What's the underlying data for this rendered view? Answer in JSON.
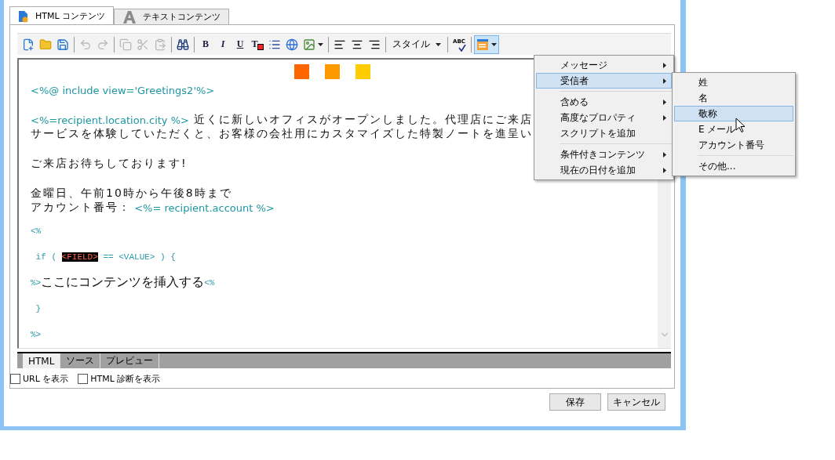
{
  "tabs": [
    {
      "label": "HTML コンテンツ",
      "kind": "html",
      "selected": true
    },
    {
      "label": "テキストコンテンツ",
      "kind": "text",
      "selected": false
    }
  ],
  "toolbar": {
    "groups": [
      [
        {
          "kind": "new",
          "disabled": false,
          "pressed": false
        },
        {
          "kind": "open",
          "disabled": false,
          "pressed": false
        },
        {
          "kind": "save",
          "disabled": false,
          "pressed": false
        }
      ],
      [
        {
          "kind": "undo",
          "disabled": true,
          "pressed": false
        },
        {
          "kind": "redo",
          "disabled": true,
          "pressed": false
        }
      ],
      [
        {
          "kind": "copy",
          "disabled": true,
          "pressed": false
        },
        {
          "kind": "cut",
          "disabled": true,
          "pressed": false
        },
        {
          "kind": "paste",
          "disabled": true,
          "pressed": false
        }
      ],
      [
        {
          "kind": "find",
          "disabled": false,
          "pressed": false
        }
      ],
      [
        {
          "kind": "bold",
          "label": "B",
          "disabled": false,
          "pressed": false
        },
        {
          "kind": "italic",
          "label": "I",
          "disabled": false,
          "pressed": false
        },
        {
          "kind": "underline",
          "label": "U",
          "disabled": false,
          "pressed": false
        },
        {
          "kind": "textcolor",
          "label": "T",
          "disabled": false,
          "pressed": false
        },
        {
          "kind": "list",
          "disabled": false,
          "pressed": false
        },
        {
          "kind": "link",
          "disabled": false,
          "pressed": false
        },
        {
          "kind": "image",
          "dropdown": true,
          "disabled": false,
          "pressed": false
        }
      ],
      [
        {
          "kind": "alignleft",
          "disabled": false,
          "pressed": false
        },
        {
          "kind": "aligncenter",
          "disabled": false,
          "pressed": false
        },
        {
          "kind": "alignright",
          "disabled": false,
          "pressed": false
        }
      ],
      [
        {
          "kind": "style",
          "label": "スタイル",
          "dropdown": true,
          "disabled": false,
          "pressed": false
        }
      ],
      [
        {
          "kind": "spell",
          "label": "ABC",
          "disabled": false,
          "pressed": false
        }
      ],
      [
        {
          "kind": "personalize",
          "dropdown": true,
          "disabled": false,
          "pressed": true
        }
      ]
    ]
  },
  "editor": {
    "swatches": [
      {
        "color": "#ff6600"
      },
      {
        "color": "#ff9900"
      },
      {
        "color": "#ffcc00"
      }
    ],
    "blocks": [
      {
        "kind": "para",
        "lines": [
          [
            {
              "kind": "tag",
              "text": "<%@ include view='Greetings2'%>"
            }
          ]
        ]
      },
      {
        "kind": "para",
        "lines": [
          [
            {
              "kind": "tag",
              "text": "<%=recipient.location.city %>"
            },
            {
              "kind": "text",
              "text": " 近くに新しいオフィスがオープンしました。代理店にご来店"
            }
          ],
          [
            {
              "kind": "text",
              "text": "サービスを体験していただくと、お客様の会社用にカスタマイズした特製ノートを進呈い"
            }
          ]
        ]
      },
      {
        "kind": "para",
        "lines": [
          [
            {
              "kind": "text",
              "text": "ご来店お待ちしております!"
            }
          ]
        ]
      },
      {
        "kind": "para",
        "lines": [
          [
            {
              "kind": "text",
              "text": "金曜日、午前10時から午後8時まで"
            }
          ],
          [
            {
              "kind": "text",
              "text": "アカウント番号："
            },
            {
              "kind": "tag",
              "text": " <%= recipient.account %>"
            }
          ]
        ]
      },
      {
        "kind": "code",
        "lines": [
          [
            {
              "kind": "code",
              "text": "<%"
            }
          ],
          [
            {
              "kind": "code",
              "text": " if ( "
            },
            {
              "kind": "field",
              "text": "<FIELD>"
            },
            {
              "kind": "code",
              "text": " == <VALUE> ) {"
            }
          ],
          [
            {
              "kind": "code",
              "text": "%>"
            },
            {
              "kind": "large",
              "text": "ここにコンテンツを挿入する"
            },
            {
              "kind": "code",
              "text": "<%"
            }
          ],
          [
            {
              "kind": "code",
              "text": " }"
            }
          ],
          [
            {
              "kind": "code",
              "text": "%>"
            }
          ]
        ]
      }
    ]
  },
  "view_tabs": [
    {
      "label": "HTML",
      "selected": true
    },
    {
      "label": "ソース",
      "selected": false
    },
    {
      "label": "プレビュー",
      "selected": false
    }
  ],
  "options": [
    {
      "label": "URL を表示",
      "checked": false
    },
    {
      "label": "HTML 診断を表示",
      "checked": false
    }
  ],
  "buttons": [
    "保存",
    "キャンセル"
  ],
  "menu": {
    "groups": [
      [
        {
          "label": "メッセージ",
          "submenu": true,
          "selected": false
        },
        {
          "label": "受信者",
          "submenu": true,
          "selected": true
        }
      ],
      [
        {
          "label": "含める",
          "submenu": true,
          "selected": false
        },
        {
          "label": "高度なプロパティ",
          "submenu": true,
          "selected": false
        },
        {
          "label": "スクリプトを追加",
          "submenu": false,
          "selected": false
        }
      ],
      [
        {
          "label": "条件付きコンテンツ",
          "submenu": true,
          "selected": false
        },
        {
          "label": "現在の日付を追加",
          "submenu": true,
          "selected": false
        }
      ]
    ]
  },
  "submenu": {
    "groups": [
      [
        {
          "label": "姓",
          "selected": false
        },
        {
          "label": "名",
          "selected": false
        },
        {
          "label": "敬称",
          "selected": true
        },
        {
          "label": "E メール",
          "selected": false
        },
        {
          "label": "アカウント番号",
          "selected": false
        }
      ],
      [
        {
          "label": "その他...",
          "selected": false
        }
      ]
    ]
  }
}
